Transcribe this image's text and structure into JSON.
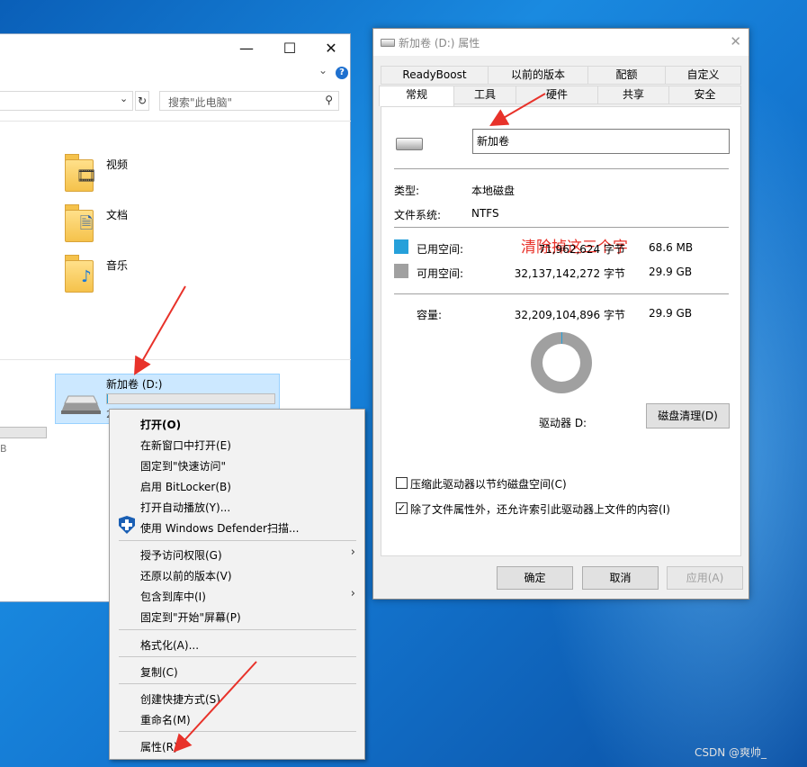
{
  "explorer": {
    "search_placeholder": "搜索\"此电脑\"",
    "folders": [
      {
        "label": "视频",
        "icon": "video-folder-icon"
      },
      {
        "label": "文档",
        "icon": "document-folder-icon"
      },
      {
        "label": "音乐",
        "icon": "music-folder-icon"
      }
    ],
    "drive": {
      "name": "新加卷 (D:)",
      "partial_text": "2",
      "used_fraction": 0.002
    },
    "left_partial_text": "B"
  },
  "context_menu": {
    "items": [
      {
        "label": "打开(O)",
        "bold": true
      },
      {
        "label": "在新窗口中打开(E)"
      },
      {
        "label": "固定到\"快速访问\""
      },
      {
        "label": "启用 BitLocker(B)"
      },
      {
        "label": "打开自动播放(Y)..."
      },
      {
        "label": "使用 Windows Defender扫描..."
      },
      {
        "label": "授予访问权限(G)",
        "submenu": true
      },
      {
        "label": "还原以前的版本(V)"
      },
      {
        "label": "包含到库中(I)",
        "submenu": true
      },
      {
        "label": "固定到\"开始\"屏幕(P)"
      },
      {
        "label": "格式化(A)..."
      },
      {
        "label": "复制(C)"
      },
      {
        "label": "创建快捷方式(S)"
      },
      {
        "label": "重命名(M)"
      },
      {
        "label": "属性(R)"
      }
    ]
  },
  "properties": {
    "title": "新加卷 (D:) 属性",
    "tabs_top": [
      "ReadyBoost",
      "以前的版本",
      "配额",
      "自定义"
    ],
    "tabs_bottom": [
      "常规",
      "工具",
      "硬件",
      "共享",
      "安全"
    ],
    "active_tab": "常规",
    "volume_name": "新加卷",
    "annotation": "清除掉这三个字",
    "type_label": "类型:",
    "type_value": "本地磁盘",
    "fs_label": "文件系统:",
    "fs_value": "NTFS",
    "used_label": "已用空间:",
    "used_bytes": "71,962,624 字节",
    "used_size": "68.6 MB",
    "free_label": "可用空间:",
    "free_bytes": "32,137,142,272 字节",
    "free_size": "29.9 GB",
    "capacity_label": "容量:",
    "capacity_bytes": "32,209,104,896 字节",
    "capacity_size": "29.9 GB",
    "drive_label": "驱动器 D:",
    "cleanup_button": "磁盘清理(D)",
    "compress_label": "压缩此驱动器以节约磁盘空间(C)",
    "compress_checked": false,
    "index_label": "除了文件属性外，还允许索引此驱动器上文件的内容(I)",
    "index_checked": true,
    "ok": "确定",
    "cancel": "取消",
    "apply": "应用(A)",
    "used_color": "#26a0da",
    "free_color": "#a0a0a0"
  },
  "watermark": "CSDN @爽帅_"
}
